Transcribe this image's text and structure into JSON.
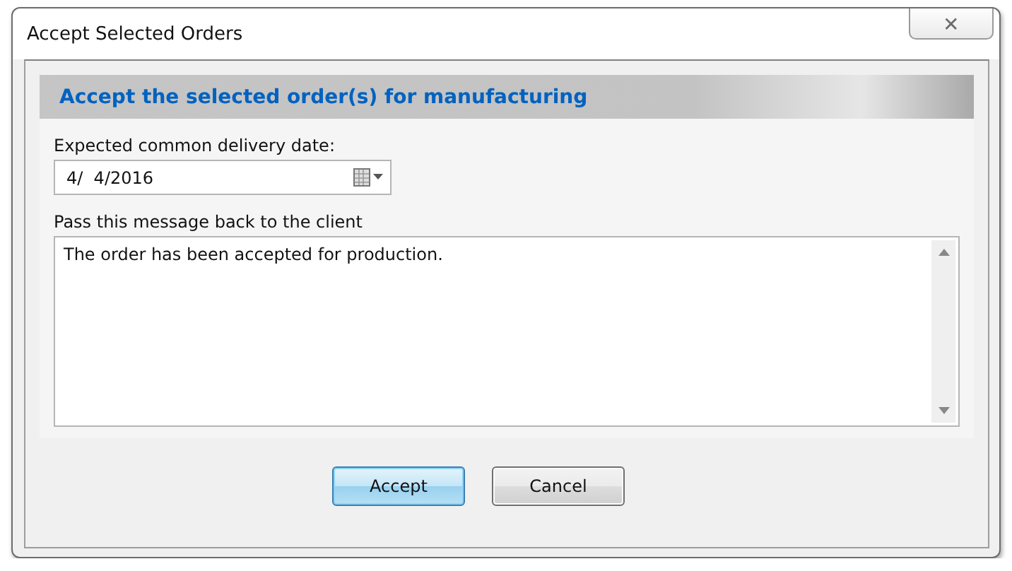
{
  "window": {
    "title": "Accept Selected Orders",
    "close_symbol": "✕"
  },
  "header": "Accept the selected order(s) for manufacturing",
  "date_field": {
    "label": "Expected common delivery date:",
    "value": "4/  4/2016"
  },
  "message_field": {
    "label": "Pass this message back to the client",
    "value": "The order has been accepted for production."
  },
  "buttons": [
    {
      "label": "Accept",
      "default": true
    },
    {
      "label": "Cancel",
      "default": false
    }
  ]
}
